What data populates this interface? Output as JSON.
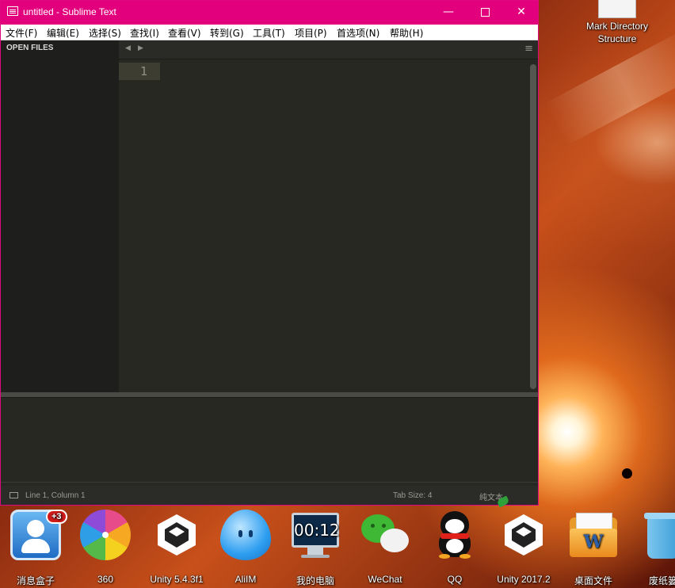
{
  "window": {
    "title": "untitled - Sublime Text",
    "controls": {
      "minimize": "—",
      "maximize": "",
      "close": "✕"
    }
  },
  "menu": [
    "文件(F)",
    "编辑(E)",
    "选择(S)",
    "查找(I)",
    "查看(V)",
    "转到(G)",
    "工具(T)",
    "项目(P)",
    "首选项(N)",
    "帮助(H)"
  ],
  "sidebar": {
    "header": "OPEN FILES"
  },
  "tabbar": {
    "nav_left": "◀",
    "nav_right": "▶",
    "menu": "≡"
  },
  "editor": {
    "line_number": "1"
  },
  "statusbar": {
    "position": "Line 1, Column 1",
    "tab_size": "Tab Size: 4",
    "syntax": "纯文本"
  },
  "desktop": {
    "icon_label": "Mark Directory Structure"
  },
  "dock": [
    {
      "label": "消息盒子",
      "icon": "message-box-icon",
      "badge": "+3"
    },
    {
      "label": "360",
      "icon": "360-browser-icon"
    },
    {
      "label": "Unity 5.4.3f1",
      "icon": "unity-icon"
    },
    {
      "label": "AliIM",
      "icon": "aliim-icon"
    },
    {
      "label": "我的电脑",
      "icon": "my-computer-icon",
      "clock": "00:12"
    },
    {
      "label": "WeChat",
      "icon": "wechat-icon"
    },
    {
      "label": "QQ",
      "icon": "qq-icon"
    },
    {
      "label": "Unity 2017.2",
      "icon": "unity-icon"
    },
    {
      "label": "桌面文件",
      "icon": "desktop-files-folder-icon",
      "glyph": "W"
    },
    {
      "label": "废纸篓",
      "icon": "trash-icon"
    }
  ],
  "colors": {
    "titlebar": "#e3007c",
    "editor_bg": "#272822",
    "sidebar_bg": "#1e1f1c"
  }
}
